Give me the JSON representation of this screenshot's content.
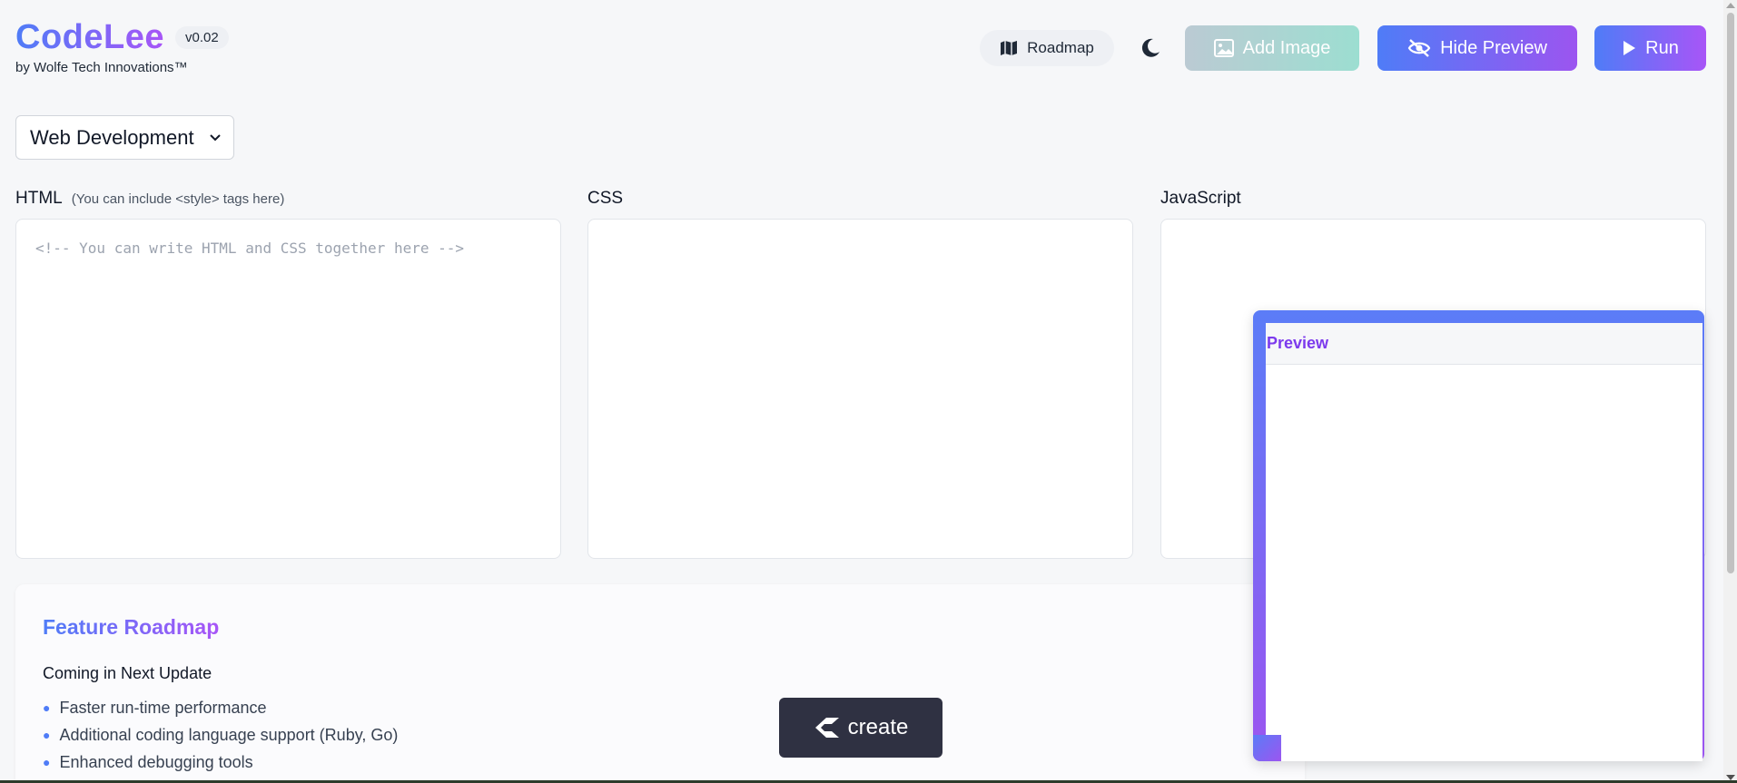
{
  "header": {
    "app_name": "CodeLee",
    "version": "v0.02",
    "byline": "by Wolfe Tech Innovations™"
  },
  "toolbar": {
    "roadmap_label": "Roadmap",
    "add_image_label": "Add Image",
    "hide_preview_label": "Hide Preview",
    "run_label": "Run"
  },
  "mode_select": {
    "selected": "Web Development"
  },
  "editors": {
    "html": {
      "label": "HTML",
      "hint": "(You can include <style> tags here)",
      "placeholder": "<!-- You can write HTML and CSS together here -->"
    },
    "css": {
      "label": "CSS"
    },
    "js": {
      "label": "JavaScript"
    }
  },
  "roadmap": {
    "title": "Feature Roadmap",
    "subtitle": "Coming in Next Update",
    "items": [
      "Faster run-time performance",
      "Additional coding language support (Ruby, Go)",
      "Enhanced debugging tools"
    ]
  },
  "preview": {
    "title": "Preview"
  },
  "floating": {
    "create_label": "create"
  },
  "colors": {
    "accent_start": "#4f7cf7",
    "accent_end": "#a855f7",
    "create_bg": "#2f3142"
  }
}
